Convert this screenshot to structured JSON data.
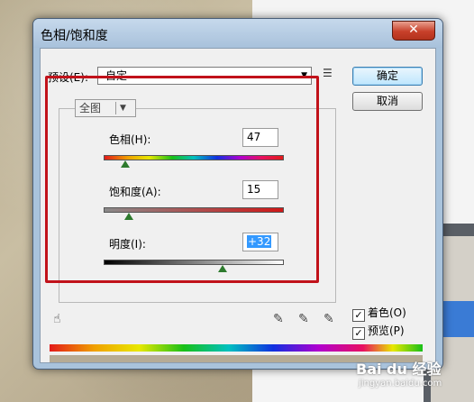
{
  "window": {
    "title": "色相/饱和度",
    "close_glyph": "✕"
  },
  "preset": {
    "label": "预设(E):",
    "value": "自定",
    "menu_glyph": "☰"
  },
  "buttons": {
    "ok": "确定",
    "cancel": "取消"
  },
  "channel": {
    "value": "全图"
  },
  "rows": {
    "hue": {
      "label": "色相(H):",
      "value": "47",
      "slider_fraction": 0.12
    },
    "saturation": {
      "label": "饱和度(A):",
      "value": "15",
      "slider_fraction": 0.14
    },
    "lightness": {
      "label": "明度(I):",
      "value": "+32",
      "slider_fraction": 0.66
    }
  },
  "options": {
    "colorize": {
      "label": "着色(O)",
      "checked": true
    },
    "preview": {
      "label": "预览(P)",
      "checked": true
    }
  },
  "icons": {
    "hand": "hand-tool-icon",
    "eyedropper": "eyedropper-icon",
    "eyedropper_plus": "eyedropper-plus-icon",
    "eyedropper_minus": "eyedropper-minus-icon"
  },
  "colors": {
    "annotation": "#c1121a",
    "tint_bar": "#b6ab95"
  },
  "watermark": {
    "logo": "Bai du 经验",
    "url": "jingyan.baidu.com"
  }
}
